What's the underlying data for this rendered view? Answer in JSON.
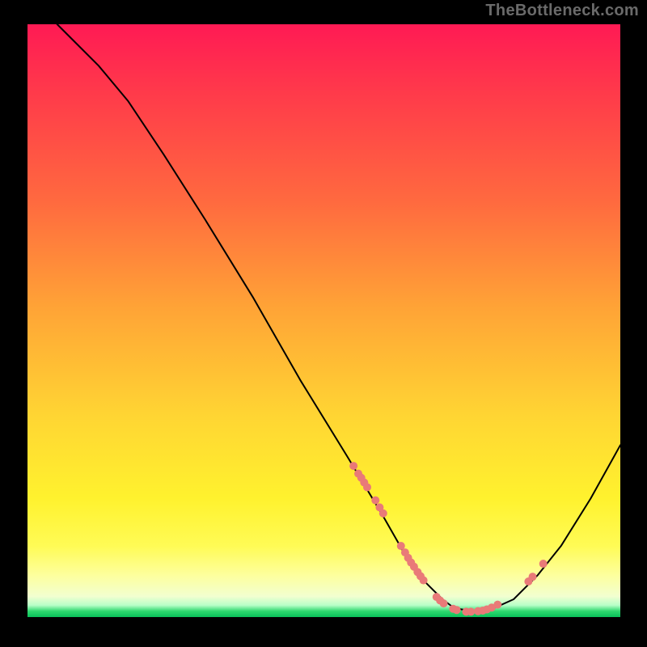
{
  "attribution": "TheBottleneck.com",
  "chart_data": {
    "type": "line",
    "title": "",
    "xlabel": "",
    "ylabel": "",
    "xlim": [
      0,
      100
    ],
    "ylim": [
      0,
      100
    ],
    "grid": false,
    "note": "V-shaped curve over vertical red→yellow→green gradient background. Coral dot markers cluster on curve between x≈55–85. Axis ranges are unlabeled; values estimated on 0–100 scale aligned to plot area.",
    "series": [
      {
        "name": "curve",
        "x": [
          5,
          8,
          12,
          17,
          23,
          30,
          38,
          46,
          54,
          60,
          64,
          67,
          70,
          72,
          75,
          78,
          82,
          86,
          90,
          95,
          100
        ],
        "y": [
          100,
          97,
          93,
          87,
          78,
          67,
          54,
          40,
          27,
          17,
          10,
          6,
          3,
          1.5,
          1,
          1.2,
          3,
          7,
          12,
          20,
          29
        ]
      }
    ],
    "markers": [
      {
        "x": 55.0,
        "y": 25.5
      },
      {
        "x": 55.8,
        "y": 24.2
      },
      {
        "x": 56.3,
        "y": 23.5
      },
      {
        "x": 56.8,
        "y": 22.7
      },
      {
        "x": 57.3,
        "y": 21.9
      },
      {
        "x": 58.7,
        "y": 19.7
      },
      {
        "x": 59.4,
        "y": 18.5
      },
      {
        "x": 60.0,
        "y": 17.5
      },
      {
        "x": 63.0,
        "y": 12.0
      },
      {
        "x": 63.7,
        "y": 10.9
      },
      {
        "x": 64.2,
        "y": 10.0
      },
      {
        "x": 64.7,
        "y": 9.2
      },
      {
        "x": 65.2,
        "y": 8.5
      },
      {
        "x": 65.8,
        "y": 7.6
      },
      {
        "x": 66.3,
        "y": 6.9
      },
      {
        "x": 66.8,
        "y": 6.2
      },
      {
        "x": 69.0,
        "y": 3.4
      },
      {
        "x": 69.6,
        "y": 2.8
      },
      {
        "x": 70.2,
        "y": 2.3
      },
      {
        "x": 71.8,
        "y": 1.4
      },
      {
        "x": 72.4,
        "y": 1.2
      },
      {
        "x": 74.0,
        "y": 0.9
      },
      {
        "x": 74.8,
        "y": 0.9
      },
      {
        "x": 76.0,
        "y": 1.0
      },
      {
        "x": 76.8,
        "y": 1.1
      },
      {
        "x": 77.5,
        "y": 1.3
      },
      {
        "x": 78.3,
        "y": 1.6
      },
      {
        "x": 79.3,
        "y": 2.1
      },
      {
        "x": 84.5,
        "y": 6.0
      },
      {
        "x": 85.2,
        "y": 6.8
      },
      {
        "x": 87.0,
        "y": 9.0
      }
    ],
    "marker_style": {
      "color": "#e97a78",
      "radius_px": 5
    },
    "gradient_stops": [
      {
        "pos": 0.0,
        "color": "#ff1a54"
      },
      {
        "pos": 0.3,
        "color": "#ff6a3f"
      },
      {
        "pos": 0.66,
        "color": "#ffd533"
      },
      {
        "pos": 0.93,
        "color": "#fdff9e"
      },
      {
        "pos": 1.0,
        "color": "#09c05a"
      }
    ]
  }
}
